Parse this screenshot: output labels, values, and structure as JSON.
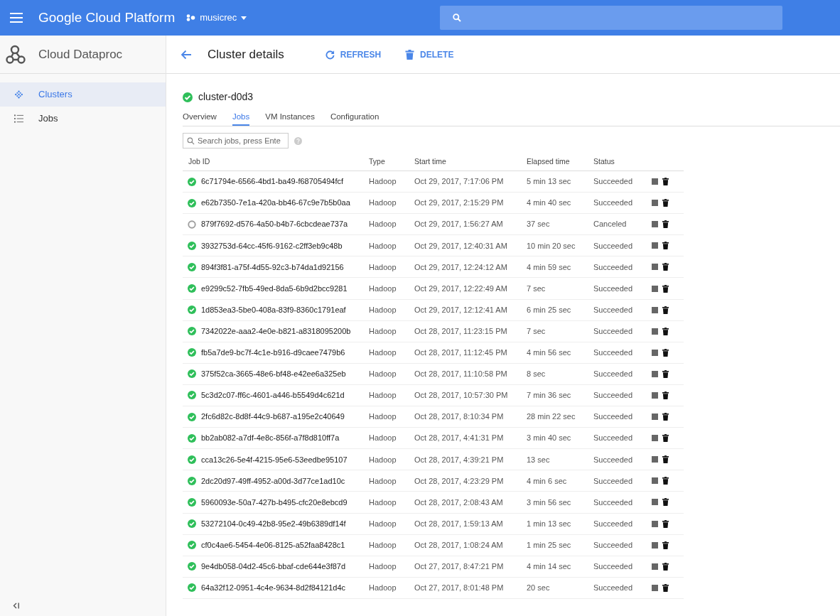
{
  "topbar": {
    "brand": "Google Cloud Platform",
    "project": "musicrec"
  },
  "sidebar": {
    "title": "Cloud Dataproc",
    "items": [
      {
        "label": "Clusters",
        "kind": "clusters",
        "selected": true
      },
      {
        "label": "Jobs",
        "kind": "jobs",
        "selected": false
      }
    ]
  },
  "header": {
    "title": "Cluster details",
    "actions": [
      {
        "label": "REFRESH",
        "kind": "refresh"
      },
      {
        "label": "DELETE",
        "kind": "delete"
      }
    ]
  },
  "cluster": {
    "name": "cluster-d0d3"
  },
  "tabs": [
    {
      "label": "Overview",
      "selected": false
    },
    {
      "label": "Jobs",
      "selected": true
    },
    {
      "label": "VM Instances",
      "selected": false
    },
    {
      "label": "Configuration",
      "selected": false
    }
  ],
  "search": {
    "placeholder": "Search jobs, press Ente"
  },
  "table": {
    "columns": [
      "Job ID",
      "Type",
      "Start time",
      "Elapsed time",
      "Status"
    ],
    "rows": [
      {
        "kind": "succeeded",
        "job_id": "6c71794e-6566-4bd1-ba49-f68705494fcf",
        "type": "Hadoop",
        "start": "Oct 29, 2017, 7:17:06 PM",
        "elapsed": "5 min 13 sec",
        "status": "Succeeded"
      },
      {
        "kind": "succeeded",
        "job_id": "e62b7350-7e1a-420a-bb46-67c9e7b5b0aa",
        "type": "Hadoop",
        "start": "Oct 29, 2017, 2:15:29 PM",
        "elapsed": "4 min 40 sec",
        "status": "Succeeded"
      },
      {
        "kind": "canceled",
        "job_id": "879f7692-d576-4a50-b4b7-6cbcdeae737a",
        "type": "Hadoop",
        "start": "Oct 29, 2017, 1:56:27 AM",
        "elapsed": "37 sec",
        "status": "Canceled"
      },
      {
        "kind": "succeeded",
        "job_id": "3932753d-64cc-45f6-9162-c2ff3eb9c48b",
        "type": "Hadoop",
        "start": "Oct 29, 2017, 12:40:31 AM",
        "elapsed": "10 min 20 sec",
        "status": "Succeeded"
      },
      {
        "kind": "succeeded",
        "job_id": "894f3f81-a75f-4d55-92c3-b74da1d92156",
        "type": "Hadoop",
        "start": "Oct 29, 2017, 12:24:12 AM",
        "elapsed": "4 min 59 sec",
        "status": "Succeeded"
      },
      {
        "kind": "succeeded",
        "job_id": "e9299c52-7fb5-49ed-8da5-6b9d2bcc9281",
        "type": "Hadoop",
        "start": "Oct 29, 2017, 12:22:49 AM",
        "elapsed": "7 sec",
        "status": "Succeeded"
      },
      {
        "kind": "succeeded",
        "job_id": "1d853ea3-5be0-408a-83f9-8360c1791eaf",
        "type": "Hadoop",
        "start": "Oct 29, 2017, 12:12:41 AM",
        "elapsed": "6 min 25 sec",
        "status": "Succeeded"
      },
      {
        "kind": "succeeded",
        "job_id": "7342022e-aaa2-4e0e-b821-a8318095200b",
        "type": "Hadoop",
        "start": "Oct 28, 2017, 11:23:15 PM",
        "elapsed": "7 sec",
        "status": "Succeeded"
      },
      {
        "kind": "succeeded",
        "job_id": "fb5a7de9-bc7f-4c1e-b916-d9caee7479b6",
        "type": "Hadoop",
        "start": "Oct 28, 2017, 11:12:45 PM",
        "elapsed": "4 min 56 sec",
        "status": "Succeeded"
      },
      {
        "kind": "succeeded",
        "job_id": "375f52ca-3665-48e6-bf48-e42ee6a325eb",
        "type": "Hadoop",
        "start": "Oct 28, 2017, 11:10:58 PM",
        "elapsed": "8 sec",
        "status": "Succeeded"
      },
      {
        "kind": "succeeded",
        "job_id": "5c3d2c07-ff6c-4601-a446-b5549d4c621d",
        "type": "Hadoop",
        "start": "Oct 28, 2017, 10:57:30 PM",
        "elapsed": "7 min 36 sec",
        "status": "Succeeded"
      },
      {
        "kind": "succeeded",
        "job_id": "2fc6d82c-8d8f-44c9-b687-a195e2c40649",
        "type": "Hadoop",
        "start": "Oct 28, 2017, 8:10:34 PM",
        "elapsed": "28 min 22 sec",
        "status": "Succeeded"
      },
      {
        "kind": "succeeded",
        "job_id": "bb2ab082-a7df-4e8c-856f-a7f8d810ff7a",
        "type": "Hadoop",
        "start": "Oct 28, 2017, 4:41:31 PM",
        "elapsed": "3 min 40 sec",
        "status": "Succeeded"
      },
      {
        "kind": "succeeded",
        "job_id": "cca13c26-5e4f-4215-95e6-53eedbe95107",
        "type": "Hadoop",
        "start": "Oct 28, 2017, 4:39:21 PM",
        "elapsed": "13 sec",
        "status": "Succeeded"
      },
      {
        "kind": "succeeded",
        "job_id": "2dc20d97-49ff-4952-a00d-3d77ce1ad10c",
        "type": "Hadoop",
        "start": "Oct 28, 2017, 4:23:29 PM",
        "elapsed": "4 min 6 sec",
        "status": "Succeeded"
      },
      {
        "kind": "succeeded",
        "job_id": "5960093e-50a7-427b-b495-cfc20e8ebcd9",
        "type": "Hadoop",
        "start": "Oct 28, 2017, 2:08:43 AM",
        "elapsed": "3 min 56 sec",
        "status": "Succeeded"
      },
      {
        "kind": "succeeded",
        "job_id": "53272104-0c49-42b8-95e2-49b6389df14f",
        "type": "Hadoop",
        "start": "Oct 28, 2017, 1:59:13 AM",
        "elapsed": "1 min 13 sec",
        "status": "Succeeded"
      },
      {
        "kind": "succeeded",
        "job_id": "cf0c4ae6-5454-4e06-8125-a52faa8428c1",
        "type": "Hadoop",
        "start": "Oct 28, 2017, 1:08:24 AM",
        "elapsed": "1 min 25 sec",
        "status": "Succeeded"
      },
      {
        "kind": "succeeded",
        "job_id": "9e4db058-04d2-45c6-bbaf-cde644e3f87d",
        "type": "Hadoop",
        "start": "Oct 27, 2017, 8:47:21 PM",
        "elapsed": "4 min 14 sec",
        "status": "Succeeded"
      },
      {
        "kind": "succeeded",
        "job_id": "64a32f12-0951-4c4e-9634-8d2f84121d4c",
        "type": "Hadoop",
        "start": "Oct 27, 2017, 8:01:48 PM",
        "elapsed": "20 sec",
        "status": "Succeeded"
      }
    ]
  }
}
